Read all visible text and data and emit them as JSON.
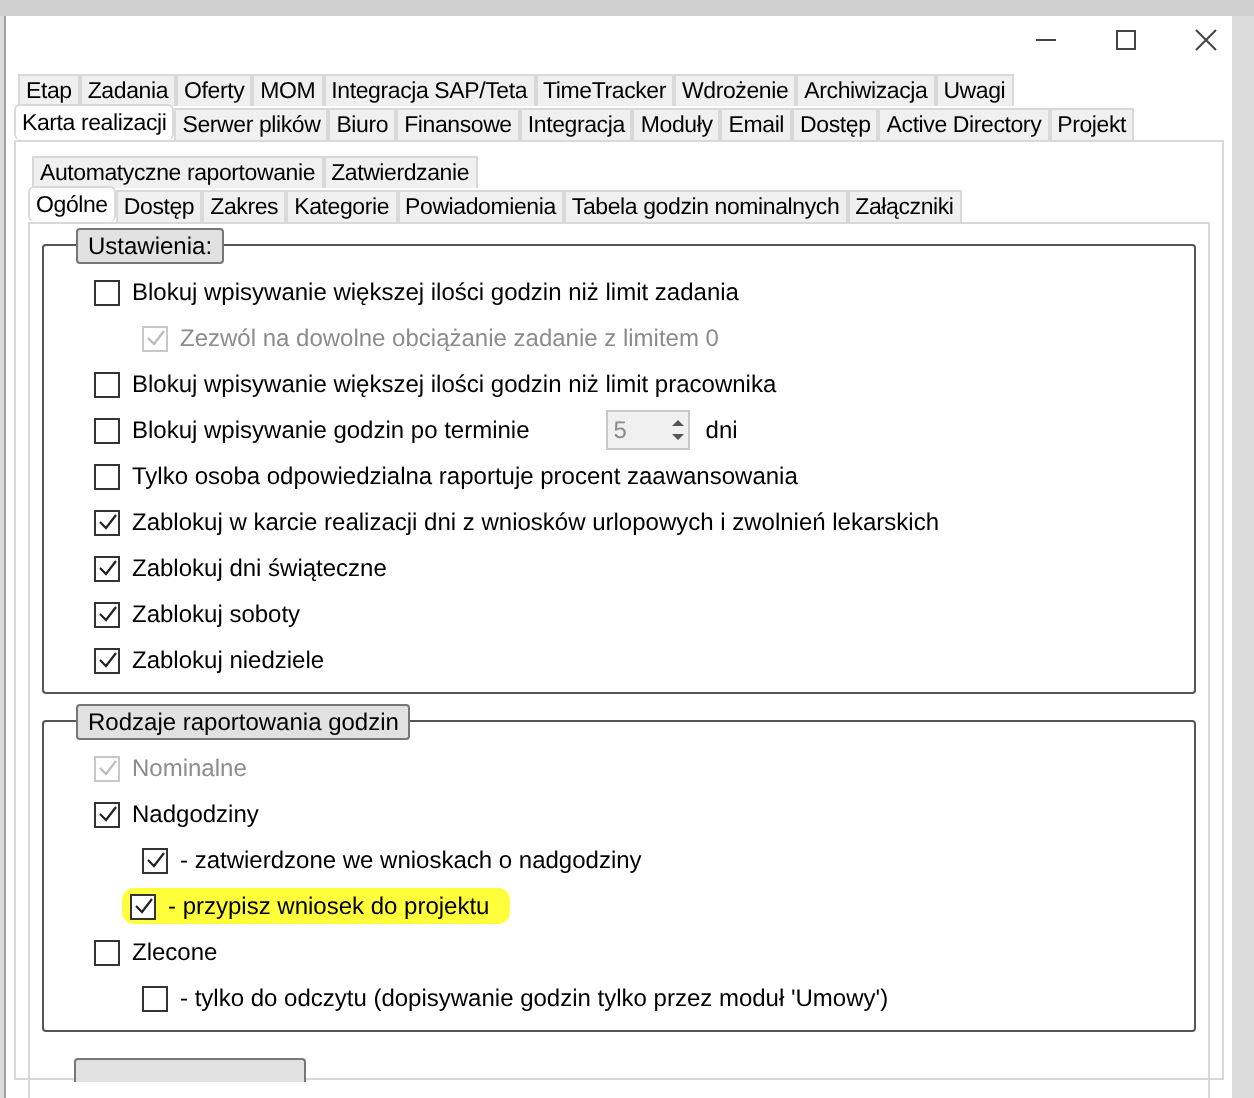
{
  "tab_rows": [
    [
      {
        "label": "Etap",
        "selected": false,
        "highlighted": false
      },
      {
        "label": "Zadania",
        "selected": false,
        "highlighted": false
      },
      {
        "label": "Oferty",
        "selected": false,
        "highlighted": false
      },
      {
        "label": "MOM",
        "selected": false,
        "highlighted": false
      },
      {
        "label": "Integracja SAP/Teta",
        "selected": false,
        "highlighted": false
      },
      {
        "label": "TimeTracker",
        "selected": false,
        "highlighted": false
      },
      {
        "label": "Wdrożenie",
        "selected": false,
        "highlighted": false
      },
      {
        "label": "Archiwizacja",
        "selected": false,
        "highlighted": false
      },
      {
        "label": "Uwagi",
        "selected": false,
        "highlighted": false
      }
    ],
    [
      {
        "label": "Karta realizacji",
        "selected": true,
        "highlighted": true
      },
      {
        "label": "Serwer plików",
        "selected": false,
        "highlighted": false
      },
      {
        "label": "Biuro",
        "selected": false,
        "highlighted": false
      },
      {
        "label": "Finansowe",
        "selected": false,
        "highlighted": false
      },
      {
        "label": "Integracja",
        "selected": false,
        "highlighted": false
      },
      {
        "label": "Moduły",
        "selected": false,
        "highlighted": false
      },
      {
        "label": "Email",
        "selected": false,
        "highlighted": false
      },
      {
        "label": "Dostęp",
        "selected": false,
        "highlighted": false
      },
      {
        "label": "Active Directory",
        "selected": false,
        "highlighted": false
      },
      {
        "label": "Projekt",
        "selected": false,
        "highlighted": false
      }
    ]
  ],
  "subtab_rows": [
    [
      {
        "label": "Automatyczne raportowanie",
        "selected": false,
        "highlighted": false
      },
      {
        "label": "Zatwierdzanie",
        "selected": false,
        "highlighted": false
      }
    ],
    [
      {
        "label": "Ogólne",
        "selected": true,
        "highlighted": true
      },
      {
        "label": "Dostęp",
        "selected": false,
        "highlighted": false
      },
      {
        "label": "Zakres",
        "selected": false,
        "highlighted": false
      },
      {
        "label": "Kategorie",
        "selected": false,
        "highlighted": false
      },
      {
        "label": "Powiadomienia",
        "selected": false,
        "highlighted": false
      },
      {
        "label": "Tabela godzin nominalnych",
        "selected": false,
        "highlighted": false
      },
      {
        "label": "Załączniki",
        "selected": false,
        "highlighted": false
      }
    ]
  ],
  "groups": [
    {
      "title": "Ustawienia:",
      "items": [
        {
          "label": "Blokuj wpisywanie większej ilości godzin niż limit zadania",
          "checked": false,
          "disabled": false,
          "children": [
            {
              "label": "Zezwól na dowolne obciążanie zadanie z limitem 0",
              "checked": true,
              "disabled": true
            }
          ]
        },
        {
          "label": "Blokuj wpisywanie większej ilości godzin niż limit pracownika",
          "checked": false,
          "disabled": false
        },
        {
          "label": "Blokuj wpisywanie godzin po terminie",
          "checked": false,
          "disabled": false,
          "spinner": {
            "value": "5",
            "disabled": true,
            "unit": "dni"
          }
        },
        {
          "label": "Tylko osoba odpowiedzialna raportuje procent zaawansowania",
          "checked": false,
          "disabled": false
        },
        {
          "label": "Zablokuj w karcie realizacji dni z wniosków urlopowych i zwolnień lekarskich",
          "checked": true,
          "disabled": false
        },
        {
          "label": "Zablokuj dni świąteczne",
          "checked": true,
          "disabled": false
        },
        {
          "label": "Zablokuj soboty",
          "checked": true,
          "disabled": false
        },
        {
          "label": "Zablokuj niedziele",
          "checked": true,
          "disabled": false
        }
      ]
    },
    {
      "title": "Rodzaje raportowania godzin",
      "items": [
        {
          "label": "Nominalne",
          "checked": true,
          "disabled": true
        },
        {
          "label": "Nadgodziny",
          "checked": true,
          "disabled": false,
          "children": [
            {
              "label": "- zatwierdzone we wnioskach o nadgodziny",
              "checked": true,
              "disabled": false
            },
            {
              "label": "- przypisz wniosek do projektu",
              "checked": true,
              "disabled": false,
              "highlighted": true
            }
          ]
        },
        {
          "label": "Zlecone",
          "checked": false,
          "disabled": false,
          "children": [
            {
              "label": "- tylko do odczytu (dopisywanie godzin tylko przez moduł 'Umowy')",
              "checked": false,
              "disabled": false
            }
          ]
        }
      ]
    }
  ]
}
